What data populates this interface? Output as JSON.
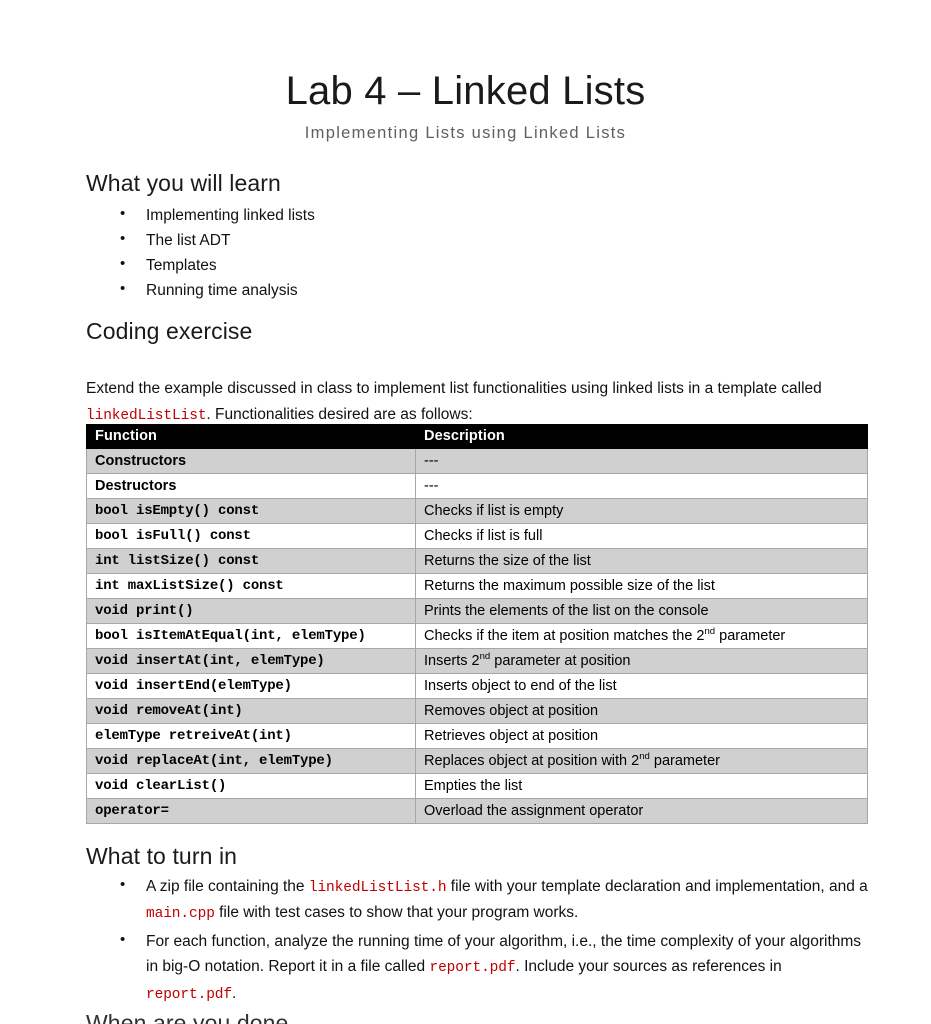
{
  "document": {
    "title": "Lab 4 – Linked Lists",
    "subtitle": "Implementing Lists using Linked Lists"
  },
  "sections": {
    "learn": {
      "heading": "What you will learn",
      "items": [
        "Implementing linked lists",
        "The list ADT",
        "Templates",
        "Running time analysis"
      ]
    },
    "coding": {
      "heading": "Coding exercise",
      "paragraph_part1": "Extend the example discussed in class to implement list functionalities using linked lists in a template called ",
      "paragraph_code": "linkedListList",
      "paragraph_part2": ". Functionalities desired are as follows:"
    },
    "turnin": {
      "heading": "What to turn in",
      "bullet1_part1": "A zip file containing the ",
      "bullet1_code1": "linkedListList.h",
      "bullet1_part2": " file with your template declaration and implementation, and a ",
      "bullet1_code2": "main.cpp",
      "bullet1_part3": " file with test cases to show that your program works.",
      "bullet2_part1": "For each function, analyze the running time of your algorithm, i.e., the time complexity of your algorithms in big-O notation. Report it in a file called ",
      "bullet2_code1": "report.pdf",
      "bullet2_part2": ". Include your sources as references in ",
      "bullet2_code2": "report.pdf",
      "bullet2_part3": "."
    },
    "cutoff": {
      "heading": "When are you done"
    }
  },
  "table": {
    "headers": [
      "Function",
      "Description"
    ],
    "rows": [
      {
        "function": "Constructors",
        "style": "word",
        "description": "---"
      },
      {
        "function": "Destructors",
        "style": "word",
        "description": "---"
      },
      {
        "function": "bool isEmpty() const",
        "style": "sig",
        "description": "Checks if list is empty"
      },
      {
        "function": "bool isFull() const",
        "style": "sig",
        "description": "Checks if list is full"
      },
      {
        "function": "int listSize() const",
        "style": "sig",
        "description": "Returns the size of the list"
      },
      {
        "function": "int maxListSize() const",
        "style": "sig",
        "description": "Returns the maximum possible size of the list"
      },
      {
        "function": "void print()",
        "style": "sig",
        "description": "Prints the elements of the list on the console"
      },
      {
        "function": "bool isItemAtEqual(int, elemType)",
        "style": "sig",
        "description_pre": "Checks if the item at position matches the 2",
        "description_sup": "nd",
        "description_post": " parameter"
      },
      {
        "function": "void insertAt(int, elemType)",
        "style": "sig",
        "description_pre": "Inserts 2",
        "description_sup": "nd",
        "description_post": " parameter at position"
      },
      {
        "function": "void insertEnd(elemType)",
        "style": "sig",
        "description": "Inserts object to end of the list"
      },
      {
        "function": "void removeAt(int)",
        "style": "sig",
        "description": "Removes object at position"
      },
      {
        "function": "elemType retreiveAt(int)",
        "style": "sig",
        "description": "Retrieves object at position"
      },
      {
        "function": "void replaceAt(int, elemType)",
        "style": "sig",
        "description_pre": "Replaces object at position with 2",
        "description_sup": "nd",
        "description_post": " parameter"
      },
      {
        "function": "void clearList()",
        "style": "sig",
        "description": "Empties the list"
      },
      {
        "function": "operator=",
        "style": "sig",
        "description": "Overload the assignment operator"
      }
    ]
  },
  "colors": {
    "code_red": "#c00000",
    "table_header_bg": "#000000",
    "table_row_shade": "#d0d0d0",
    "subtitle_gray": "#5f5f5f"
  }
}
